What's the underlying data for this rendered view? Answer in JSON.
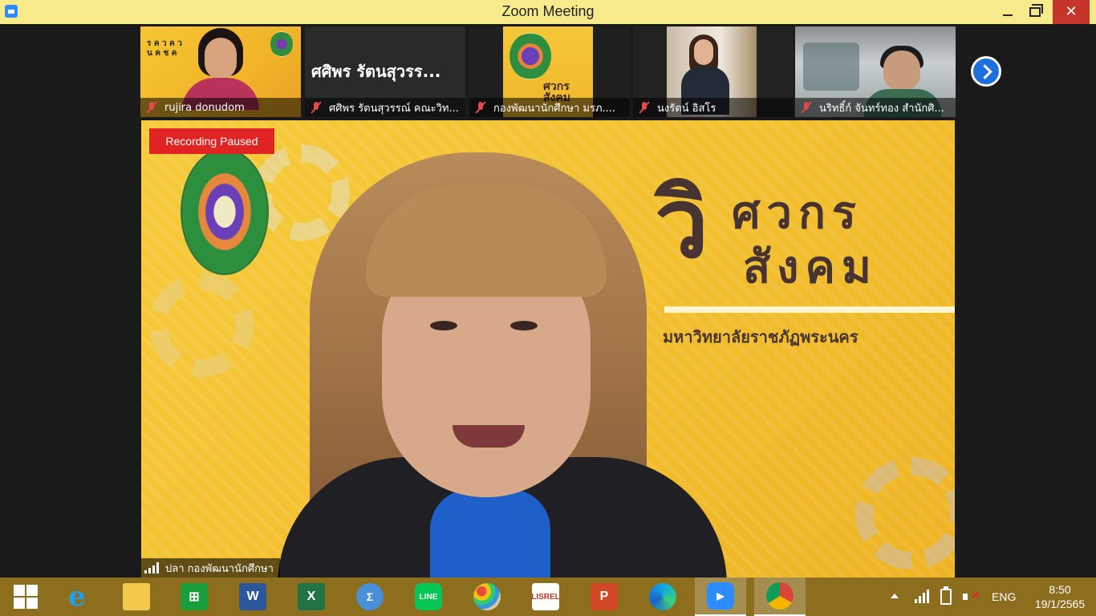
{
  "window": {
    "title": "Zoom Meeting"
  },
  "thumbnails": [
    {
      "name": "rujira donudom",
      "muted": true
    },
    {
      "name": "ศศิพร รัตนสุวรรณ์ คณะวิท...",
      "display_name": "ศศิพร รัตนสุวรร...",
      "muted": true
    },
    {
      "name": "กองพัฒนานักศึกษา มรภ....",
      "muted": true
    },
    {
      "name": "นงรัตน์ อิสโร",
      "muted": true
    },
    {
      "name": "นริทธิ์ก์ จันทร์ทอง สำนักศิ...",
      "muted": true
    }
  ],
  "main_video": {
    "recording_status": "Recording Paused",
    "speaker_name": "ปลา กองพัฒนานักศึกษา",
    "poster": {
      "big_char": "วิ",
      "line1": "ศวกร",
      "line2": "สังคม",
      "university": "มหาวิทยาลัยราชภัฏพระนคร"
    }
  },
  "thumb_texts": {
    "t1": "ร ค ว ค ว\nน ค ช ค",
    "t3": "ศวกร\nสังคม"
  },
  "taskbar": {
    "items": [
      "start",
      "internet-explorer",
      "file-explorer",
      "store",
      "word",
      "excel",
      "math-input",
      "line",
      "paint",
      "lisrel",
      "powerpoint",
      "edge",
      "zoom",
      "chrome"
    ],
    "active": "zoom",
    "colors": {
      "bar": "#8c6e1e",
      "word": "#2b579a",
      "excel": "#217346",
      "powerpoint": "#d24726",
      "line": "#06c755",
      "zoom": "#2d8cff",
      "store": "#1a9e3b"
    }
  },
  "tray": {
    "language": "ENG",
    "time": "8:50",
    "date": "19/1/2565"
  }
}
